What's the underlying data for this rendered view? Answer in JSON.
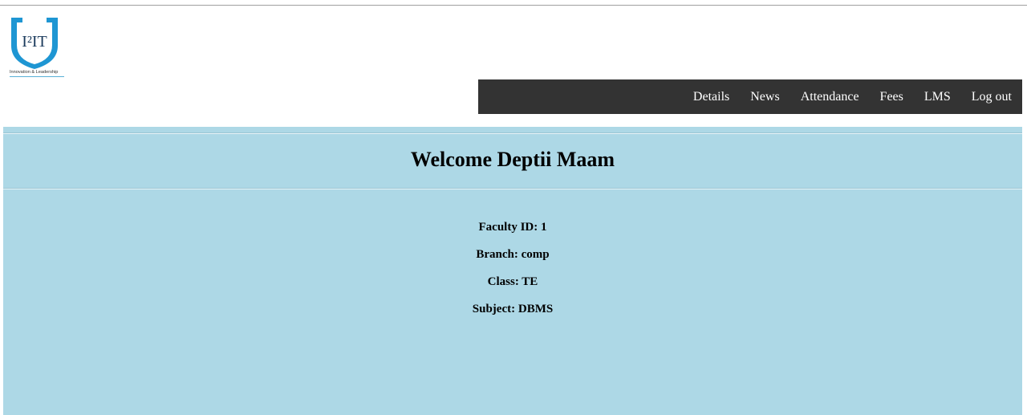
{
  "logo": {
    "mark_text": "I²IT",
    "caption": "Innovation & Leadership",
    "colors": {
      "blue": "#1e96d3",
      "dark": "#1a3a5c"
    }
  },
  "nav": {
    "items": [
      {
        "label": "Details"
      },
      {
        "label": "News"
      },
      {
        "label": "Attendance"
      },
      {
        "label": "Fees"
      },
      {
        "label": "LMS"
      },
      {
        "label": "Log out"
      }
    ],
    "background": "#333333"
  },
  "main": {
    "welcome": "Welcome Deptii Maam",
    "background": "#add8e6",
    "info": {
      "faculty_id": "Faculty ID: 1",
      "branch": "Branch: comp",
      "class": "Class: TE",
      "subject": "Subject: DBMS"
    }
  }
}
